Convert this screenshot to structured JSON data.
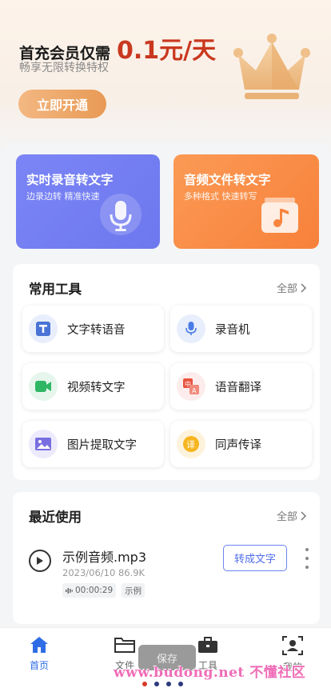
{
  "promo": {
    "prefix": "首充会员仅需",
    "price": "0.1元/天",
    "subtitle": "畅享无限转换特权",
    "button": "立即开通"
  },
  "features": [
    {
      "title": "实时录音转文字",
      "subtitle": "边录边转  精准快速",
      "icon": "microphone-icon",
      "color": "#6f7af0"
    },
    {
      "title": "音频文件转文字",
      "subtitle": "多种格式  快速转写",
      "icon": "music-file-icon",
      "color": "#f8853f"
    }
  ],
  "tools": {
    "title": "常用工具",
    "more": "全部",
    "items": [
      {
        "label": "文字转语音",
        "icon": "text-icon"
      },
      {
        "label": "录音机",
        "icon": "microphone-icon"
      },
      {
        "label": "视频转文字",
        "icon": "video-icon"
      },
      {
        "label": "语音翻译",
        "icon": "translate-icon"
      },
      {
        "label": "图片提取文字",
        "icon": "image-icon"
      },
      {
        "label": "同声传译",
        "icon": "interpret-icon"
      }
    ]
  },
  "recent": {
    "title": "最近使用",
    "more": "全部",
    "file": {
      "name": "示例音频.mp3",
      "meta": "2023/06/10 86.9K",
      "duration": "00:00:29",
      "tag": "示例",
      "action": "转成文字"
    }
  },
  "nav": {
    "items": [
      {
        "label": "首页",
        "icon": "home-icon",
        "active": true
      },
      {
        "label": "文件",
        "icon": "folder-icon"
      },
      {
        "label": "工具",
        "icon": "briefcase-icon"
      },
      {
        "label": "我的",
        "icon": "user-icon"
      }
    ]
  },
  "toast": "保存",
  "watermark": "www.budong.net  不懂社区",
  "colors": {
    "accent": "#2f6de6",
    "promo_price": "#c9381f",
    "button_gradient": "#e89a55"
  }
}
